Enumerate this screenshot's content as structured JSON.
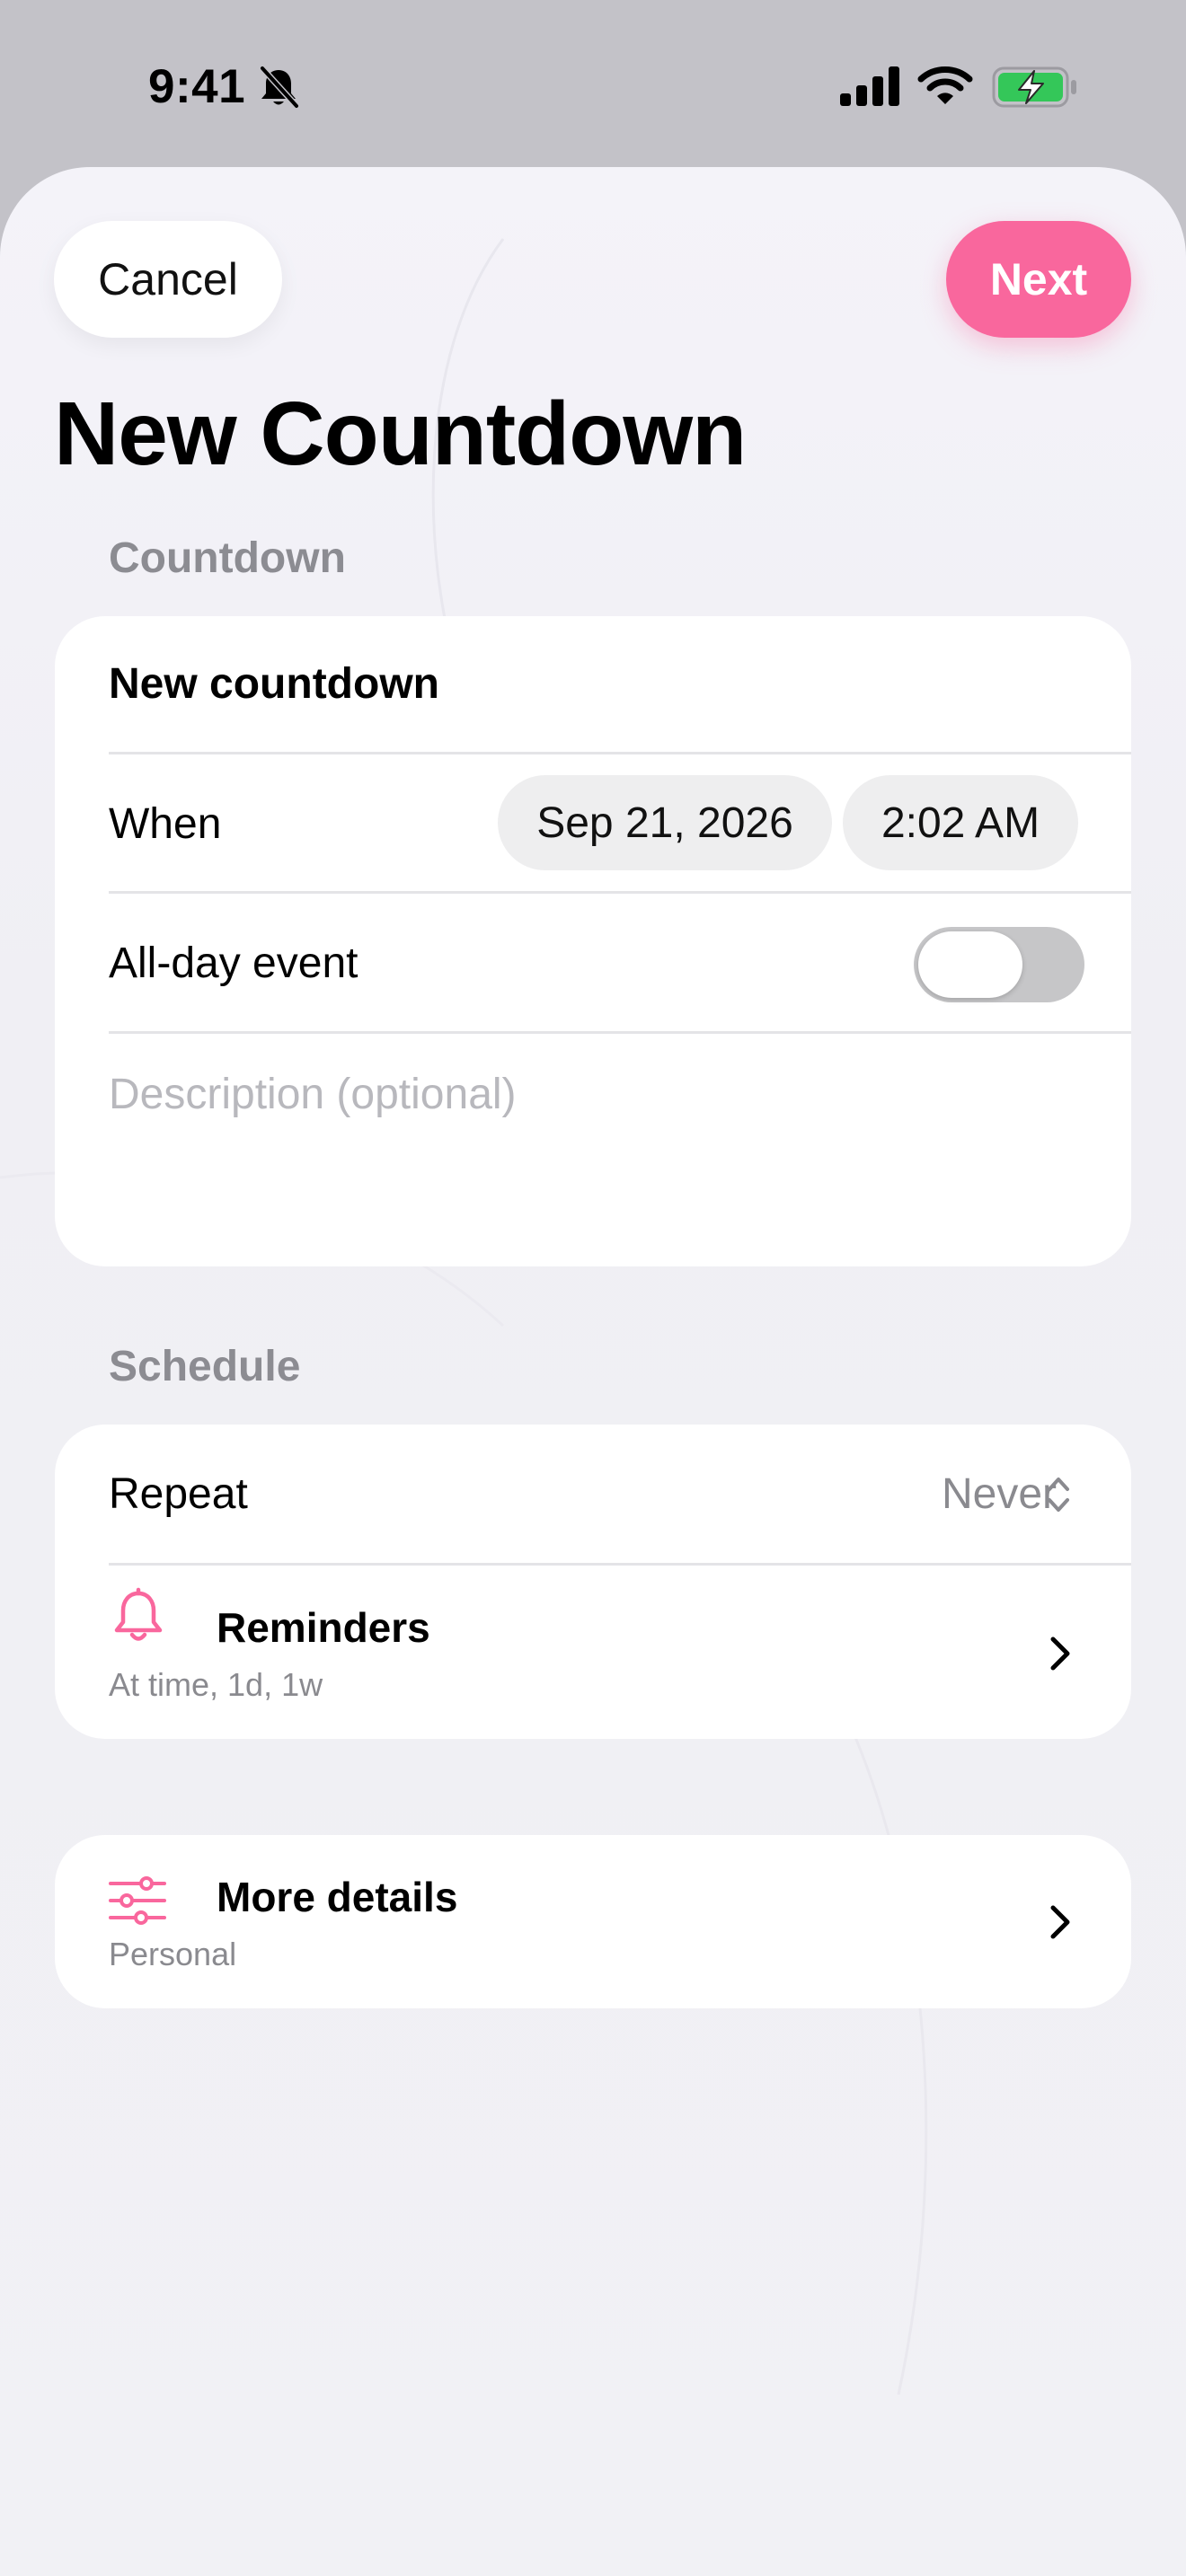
{
  "status_bar": {
    "time": "9:41"
  },
  "header": {
    "cancel_label": "Cancel",
    "next_label": "Next",
    "title": "New Countdown"
  },
  "countdown_section": {
    "header": "Countdown",
    "name_value": "New countdown",
    "when_label": "When",
    "date_value": "Sep 21, 2026",
    "time_value": "2:02 AM",
    "all_day_label": "All-day event",
    "all_day_on": false,
    "description_placeholder": "Description (optional)"
  },
  "schedule_section": {
    "header": "Schedule",
    "repeat_label": "Repeat",
    "repeat_value": "Never",
    "reminders_title": "Reminders",
    "reminders_subtitle": "At time, 1d, 1w"
  },
  "details_section": {
    "title": "More details",
    "subtitle": "Personal"
  },
  "icons": {
    "silent": "bell-slash-icon",
    "signal": "cellular-signal-icon",
    "wifi": "wifi-icon",
    "battery": "battery-charging-icon",
    "reminders": "bell-icon",
    "details": "sliders-icon",
    "repeat": "chevron-up-down-icon",
    "disclosure": "chevron-right-icon"
  },
  "colors": {
    "accent": "#f9679d",
    "battery_fill": "#34c759",
    "secondary_text": "#8a8a8f",
    "background": "#f2f2f7"
  }
}
